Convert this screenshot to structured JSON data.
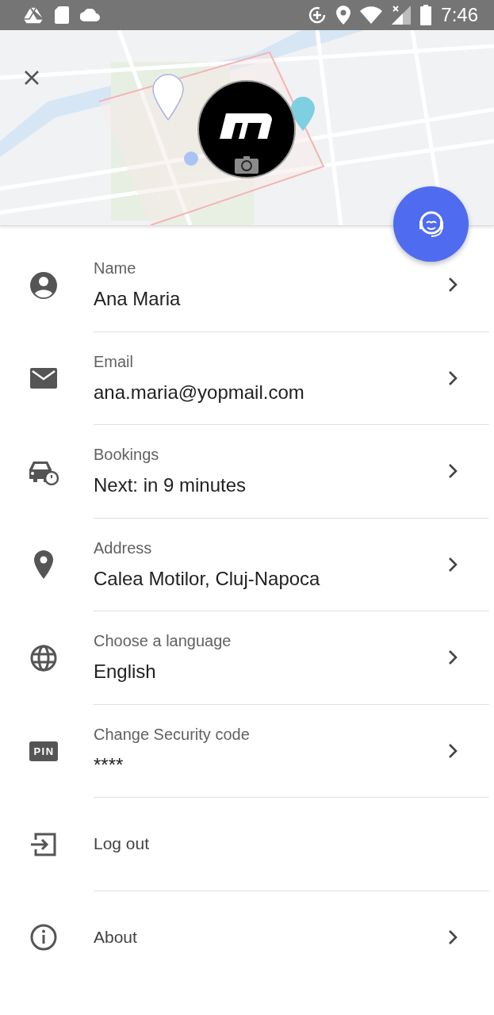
{
  "status_bar": {
    "time": "7:46"
  },
  "items": [
    {
      "kind": "detail",
      "label": "Name",
      "value": "Ana Maria",
      "chevron": true
    },
    {
      "kind": "detail",
      "label": "Email",
      "value": "ana.maria@yopmail.com",
      "chevron": true
    },
    {
      "kind": "detail",
      "label": "Bookings",
      "value": "Next: in 9 minutes",
      "chevron": true
    },
    {
      "kind": "detail",
      "label": "Address",
      "value": "Calea Motilor, Cluj-Napoca",
      "chevron": true
    },
    {
      "kind": "detail",
      "label": "Choose a language",
      "value": "English",
      "chevron": true
    },
    {
      "kind": "detail",
      "badge": "PIN",
      "label": "Change Security code",
      "value": "****",
      "chevron": true
    },
    {
      "kind": "action",
      "label": "Log out",
      "chevron": false
    },
    {
      "kind": "action",
      "label": "About",
      "chevron": true
    }
  ]
}
